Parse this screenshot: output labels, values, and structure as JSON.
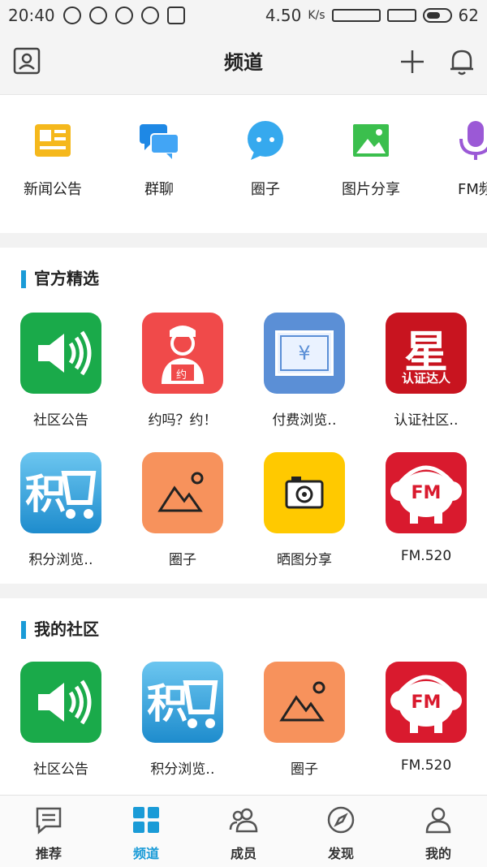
{
  "status": {
    "time": "20:40",
    "speed": "4.50",
    "speed_unit": "K/s",
    "battery": "62"
  },
  "header": {
    "title": "频道"
  },
  "channels": [
    {
      "label": "新闻公告",
      "icon": "news-icon"
    },
    {
      "label": "群聊",
      "icon": "chat-icon"
    },
    {
      "label": "圈子",
      "icon": "bubble-icon"
    },
    {
      "label": "图片分享",
      "icon": "image-icon"
    },
    {
      "label": "FM频",
      "icon": "mic-icon"
    }
  ],
  "official": {
    "title": "官方精选",
    "items": [
      {
        "label": "社区公告",
        "icon": "speaker-icon"
      },
      {
        "label": "约吗？约！",
        "icon": "person-icon",
        "badge": "约"
      },
      {
        "label": "付费浏览‥",
        "icon": "yen-icon",
        "symbol": "¥"
      },
      {
        "label": "认证社区‥",
        "icon": "star-badge-icon",
        "big": "星",
        "sub": "认证达人"
      },
      {
        "label": "积分浏览‥",
        "icon": "cart-icon",
        "big": "积"
      },
      {
        "label": "圈子",
        "icon": "mountain-icon"
      },
      {
        "label": "晒图分享",
        "icon": "camera-icon"
      },
      {
        "label": "FM.520",
        "icon": "fm-elephant-icon",
        "fm": "FM"
      }
    ]
  },
  "mine": {
    "title": "我的社区",
    "items": [
      {
        "label": "社区公告",
        "icon": "speaker-icon"
      },
      {
        "label": "积分浏览‥",
        "icon": "cart-icon",
        "big": "积"
      },
      {
        "label": "圈子",
        "icon": "mountain-icon"
      },
      {
        "label": "FM.520",
        "icon": "fm-elephant-icon",
        "fm": "FM"
      }
    ]
  },
  "tabs": [
    {
      "label": "推荐",
      "icon": "doc-icon"
    },
    {
      "label": "频道",
      "icon": "grid-icon",
      "active": true
    },
    {
      "label": "成员",
      "icon": "members-icon"
    },
    {
      "label": "发现",
      "icon": "compass-icon"
    },
    {
      "label": "我的",
      "icon": "user-icon"
    }
  ],
  "colors": {
    "accent": "#1a9bd7",
    "green": "#1aaa4a",
    "red": "#f04a4a",
    "blue": "#5b8fd6",
    "orange": "#f7925c",
    "yellow": "#ffc900",
    "crimson": "#d91a2e",
    "teal": "#2e9bd6"
  }
}
